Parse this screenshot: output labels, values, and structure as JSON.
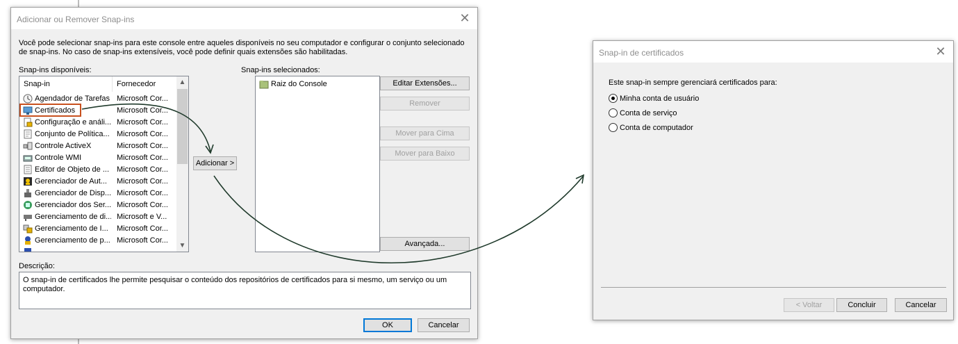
{
  "dialog1": {
    "title": "Adicionar ou Remover Snap-ins",
    "intro": "Você pode selecionar snap-ins para este console entre aqueles disponíveis no seu computador e configurar o conjunto selecionado de snap-ins. No caso de snap-ins extensíveis, você pode definir quais extensões são habilitadas.",
    "available_label": "Snap-ins disponíveis:",
    "selected_label": "Snap-ins selecionados:",
    "columns": [
      "Snap-in",
      "Fornecedor"
    ],
    "available": [
      {
        "name": "Agendador de Tarefas",
        "vendor": "Microsoft Cor...",
        "icon": "clock-icon"
      },
      {
        "name": "Certificados",
        "vendor": "Microsoft Cor...",
        "icon": "certificate-icon"
      },
      {
        "name": "Configuração e análi...",
        "vendor": "Microsoft Cor...",
        "icon": "security-config-icon"
      },
      {
        "name": "Conjunto de Política...",
        "vendor": "Microsoft Cor...",
        "icon": "policy-icon"
      },
      {
        "name": "Controle ActiveX",
        "vendor": "Microsoft Cor...",
        "icon": "activex-icon"
      },
      {
        "name": "Controle WMI",
        "vendor": "Microsoft Cor...",
        "icon": "wmi-icon"
      },
      {
        "name": "Editor de Objeto de ...",
        "vendor": "Microsoft Cor...",
        "icon": "gpo-editor-icon"
      },
      {
        "name": "Gerenciador de Aut...",
        "vendor": "Microsoft Cor...",
        "icon": "authorization-icon"
      },
      {
        "name": "Gerenciador de Disp...",
        "vendor": "Microsoft Cor...",
        "icon": "device-manager-icon"
      },
      {
        "name": "Gerenciador dos Ser...",
        "vendor": "Microsoft Cor...",
        "icon": "server-manager-icon"
      },
      {
        "name": "Gerenciamento de di...",
        "vendor": "Microsoft e V...",
        "icon": "disk-management-icon"
      },
      {
        "name": "Gerenciamento de I...",
        "vendor": "Microsoft Cor...",
        "icon": "ip-management-icon"
      },
      {
        "name": "Gerenciamento de p...",
        "vendor": "Microsoft Cor...",
        "icon": "policy-management-icon"
      }
    ],
    "selected": [
      {
        "name": "Raiz do Console",
        "icon": "folder-icon"
      }
    ],
    "add_button": "Adicionar >",
    "edit_ext_button": "Editar Extensões...",
    "remove_button": "Remover",
    "move_up_button": "Mover para Cima",
    "move_down_button": "Mover para Baixo",
    "advanced_button": "Avançada...",
    "description_label": "Descrição:",
    "description": "O snap-in de certificados lhe permite pesquisar o conteúdo dos repositórios de certificados para si mesmo, um serviço ou um computador.",
    "ok_button": "OK",
    "cancel_button": "Cancelar"
  },
  "dialog2": {
    "title": "Snap-in de certificados",
    "prompt": "Este snap-in sempre gerenciará certificados para:",
    "options": [
      {
        "label": "Minha conta de usuário",
        "checked": true
      },
      {
        "label": "Conta de serviço",
        "checked": false
      },
      {
        "label": "Conta de computador",
        "checked": false
      }
    ],
    "back_button": "< Voltar",
    "finish_button": "Concluir",
    "cancel_button": "Cancelar"
  },
  "colors": {
    "highlight_border": "#c8501e",
    "arrow": "#1f3a2b",
    "dialog_bg": "#f0f0f0",
    "default_button_border": "#0078d7"
  }
}
